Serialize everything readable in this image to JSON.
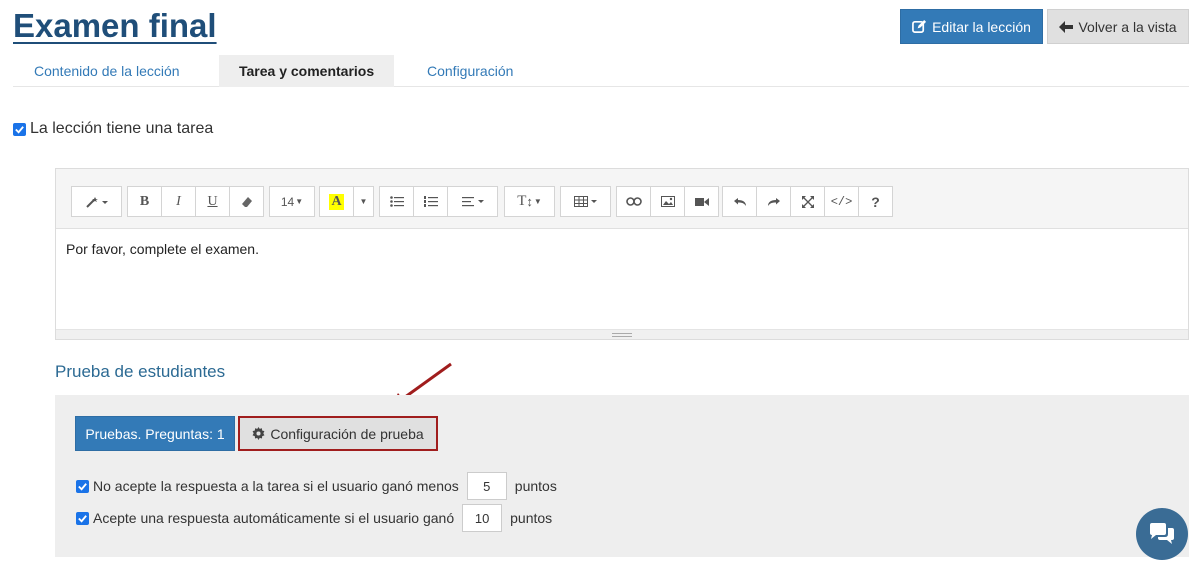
{
  "header": {
    "title": "Examen final",
    "edit_button": "Editar la lección",
    "back_button": "Volver a la vista"
  },
  "tabs": [
    {
      "label": "Contenido de la lección",
      "active": false
    },
    {
      "label": "Tarea y comentarios",
      "active": true
    },
    {
      "label": "Configuración",
      "active": false
    }
  ],
  "task": {
    "has_task_label": "La lección tiene una tarea",
    "checked": true
  },
  "editor": {
    "font_size": "14",
    "content": "Por favor, complete el examen.",
    "toolbar_icons": [
      "magic-wand-icon",
      "bold-icon",
      "italic-icon",
      "underline-icon",
      "eraser-icon",
      "font-size-select",
      "highlight-icon",
      "highlight-dropdown",
      "unordered-list-icon",
      "ordered-list-icon",
      "align-icon",
      "text-height-icon",
      "table-icon",
      "link-icon",
      "image-icon",
      "video-icon",
      "undo-icon",
      "redo-icon",
      "fullscreen-icon",
      "code-view-icon",
      "help-icon"
    ]
  },
  "student_test": {
    "section_title": "Prueba de estudiantes",
    "tests_button": "Pruebas. Preguntas: 1",
    "config_button": "Configuración de prueba",
    "options": [
      {
        "label": "No acepte la respuesta a la tarea si el usuario ganó menos",
        "value": "5",
        "suffix": "puntos",
        "checked": true
      },
      {
        "label": "Acepte una respuesta automáticamente si el usuario ganó",
        "value": "10",
        "suffix": "puntos",
        "checked": true
      }
    ]
  },
  "colors": {
    "primary": "#337ab7",
    "title": "#1f4e79",
    "highlight_border": "#a01d1d",
    "arrow": "#a01d1d",
    "chat": "#3a6c95"
  }
}
